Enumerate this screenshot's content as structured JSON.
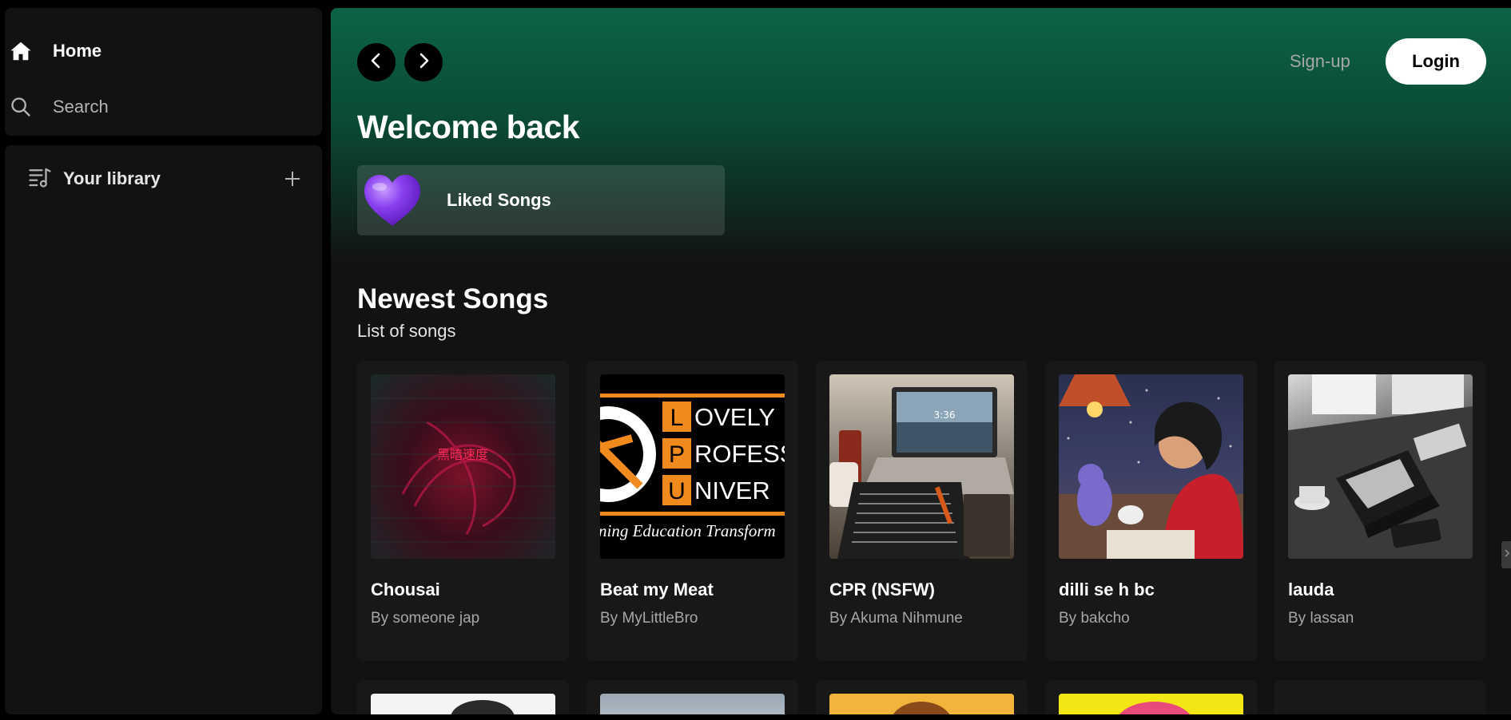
{
  "sidebar": {
    "home_label": "Home",
    "search_label": "Search",
    "library_label": "Your library"
  },
  "header": {
    "signup_label": "Sign-up",
    "login_label": "Login"
  },
  "welcome": {
    "title": "Welcome back",
    "liked_label": "Liked Songs"
  },
  "newest": {
    "title": "Newest Songs",
    "subtitle": "List of songs",
    "songs": [
      {
        "title": "Chousai",
        "artist": "By someone jap",
        "art_text": "黑暗速度"
      },
      {
        "title": "Beat my Meat",
        "artist": "By MyLittleBro",
        "art_lines": [
          "OVELY",
          "ROFESS",
          "NIVER"
        ],
        "art_letters": [
          "L",
          "P",
          "U"
        ],
        "art_tagline": "ning Education Transform"
      },
      {
        "title": "CPR (NSFW)",
        "artist": "By Akuma Nihmune",
        "art_time": "3:36"
      },
      {
        "title": "dilli se h bc",
        "artist": "By bakcho"
      },
      {
        "title": "lauda",
        "artist": "By lassan"
      }
    ]
  },
  "colors": {
    "accent_green": "#0c6445",
    "heart_purple": "#8a3ff0"
  },
  "icons": [
    "home-icon",
    "search-icon",
    "library-icon",
    "plus-icon",
    "chevron-left-icon",
    "chevron-right-icon",
    "heart-icon"
  ]
}
